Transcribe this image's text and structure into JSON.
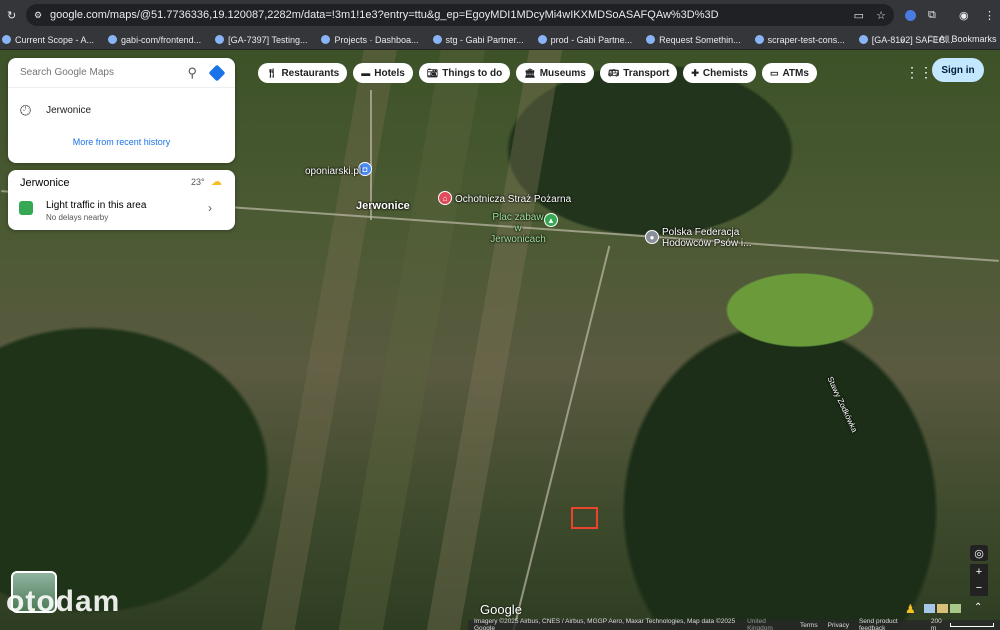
{
  "browser": {
    "url": "google.com/maps/@51.7736336,19.120087,2282m/data=!3m1!1e3?entry=ttu&g_ep=EgoyMDI1MDcyMi4wIKXMDSoASAFQAw%3D%3D",
    "bookmarks": [
      "Current Scope - A...",
      "gabi-com/frontend...",
      "[GA-7397] Testing...",
      "Projects · Dashboa...",
      "stg - Gabi Partner...",
      "prod - Gabi Partne...",
      "Request Somethin...",
      "scraper-test-cons...",
      "[GA-8102] SAFEC..."
    ],
    "all_bookmarks": "All Bookmarks"
  },
  "search": {
    "placeholder": "Search Google Maps",
    "recent": "Jerwonice",
    "more": "More from recent history"
  },
  "traffic": {
    "place": "Jerwonice",
    "temp": "23°",
    "title": "Light traffic in this area",
    "subtitle": "No delays nearby"
  },
  "chips": [
    "Restaurants",
    "Hotels",
    "Things to do",
    "Museums",
    "Transport",
    "Chemists",
    "ATMs"
  ],
  "sign_in": "Sign in",
  "map_labels": {
    "town": "Jerwonice",
    "tyre": "oponiarski.pl",
    "fire": "Ochotnicza Straż Pożarna",
    "playground": "Plac zabaw w Jerwonicach",
    "federation": "Polska Federacja Hodowców Psów i...",
    "pond": "Stawy Zodkówka"
  },
  "watermark": "otodam",
  "google": "Google",
  "footer": [
    "Imagery ©2025 Airbus, CNES / Airbus, MGGP Aero, Maxar Technologies, Map data ©2025 Google",
    "United Kingdom",
    "Terms",
    "Privacy",
    "Send product feedback",
    "200 m"
  ]
}
